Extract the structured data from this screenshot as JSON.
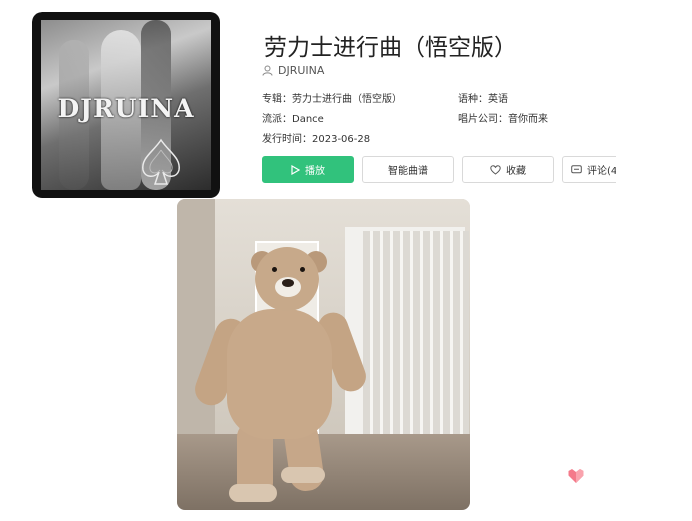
{
  "song": {
    "title": "劳力士进行曲（悟空版）",
    "artist": "DJRUINA",
    "cover_text": "DJRUINA",
    "album_label": "专辑：",
    "album": "劳力士进行曲（悟空版）",
    "language_label": "语种：",
    "language": "英语",
    "genre_label": "流派：",
    "genre": "Dance",
    "label_label": "唱片公司：",
    "label": "音你而来",
    "release_label": "发行时间：",
    "release_date": "2023-06-28"
  },
  "actions": {
    "play": "播放",
    "smart_mix": "智能曲谱",
    "favorite": "收藏",
    "comment": "评论(4"
  },
  "icons": {
    "user": "user-icon",
    "play": "play-icon",
    "heart": "heart-icon",
    "comment": "comment-icon",
    "corner": "heart-logo-icon"
  },
  "colors": {
    "play_button": "#31c27c",
    "corner_logo": "#f47a8a"
  }
}
